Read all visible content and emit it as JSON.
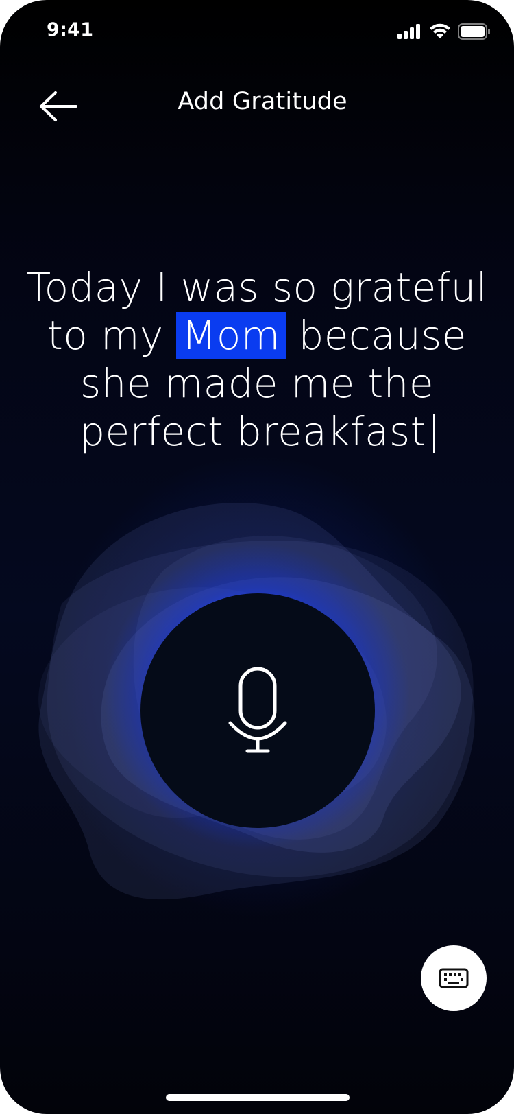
{
  "status_bar": {
    "time": "9:41",
    "icons": [
      "signal-icon",
      "wifi-icon",
      "battery-icon"
    ]
  },
  "header": {
    "title": "Add Gratitude",
    "back_icon": "arrow-left-icon"
  },
  "transcript": {
    "before_highlight": "Today I was so grateful to my ",
    "highlight": "Mom",
    "after_highlight": " because she made me the perfect breakfast"
  },
  "controls": {
    "mic_icon": "microphone-icon",
    "keyboard_icon": "keyboard-icon"
  },
  "colors": {
    "accent": "#0a3cf0",
    "background": "#04091f",
    "mic_button": "#050b18",
    "text": "#ffffff"
  }
}
